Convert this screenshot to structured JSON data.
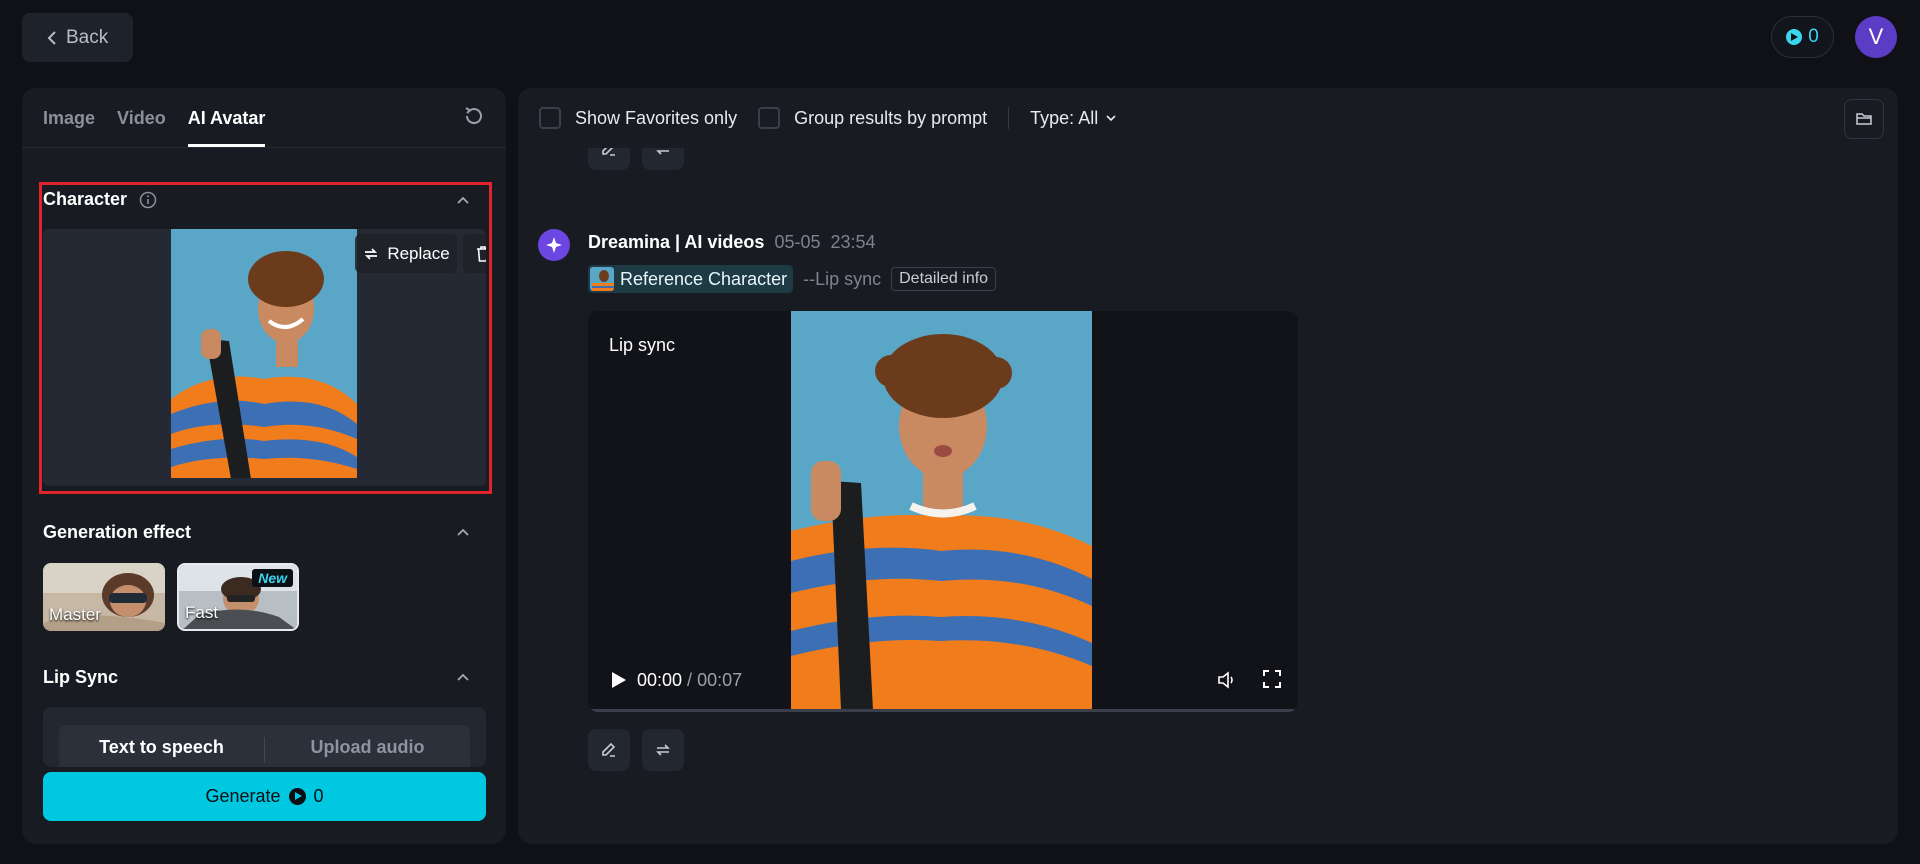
{
  "header": {
    "back_label": "Back",
    "credits": "0",
    "avatar_initial": "V"
  },
  "left_panel": {
    "tabs": [
      {
        "label": "Image",
        "active": false
      },
      {
        "label": "Video",
        "active": false
      },
      {
        "label": "AI Avatar",
        "active": true
      }
    ],
    "character": {
      "title": "Character",
      "replace_label": "Replace"
    },
    "generation_effect": {
      "title": "Generation effect",
      "options": [
        {
          "label": "Master",
          "selected": false
        },
        {
          "label": "Fast",
          "selected": true,
          "badge": "New"
        }
      ]
    },
    "lip_sync": {
      "title": "Lip Sync",
      "modes": [
        {
          "label": "Text to speech",
          "active": true
        },
        {
          "label": "Upload audio",
          "active": false
        }
      ]
    },
    "generate": {
      "label": "Generate",
      "cost": "0"
    }
  },
  "right_panel": {
    "filters": {
      "favorites_label": "Show Favorites only",
      "group_label": "Group results by prompt",
      "type_label": "Type: All"
    },
    "result": {
      "author": "Dreamina | AI videos",
      "date": "05-05",
      "time": "23:54",
      "reference_label": "Reference Character",
      "mode": "--Lip sync",
      "detail_label": "Detailed info",
      "video": {
        "label": "Lip sync",
        "current_time": "00:00",
        "separator": " / ",
        "duration": "00:07",
        "progress": 0
      }
    }
  },
  "colors": {
    "accent": "#00c8e0",
    "highlight_border": "#e0242b",
    "brand": "#6b46e0",
    "avatar": "#5b3cc4"
  }
}
